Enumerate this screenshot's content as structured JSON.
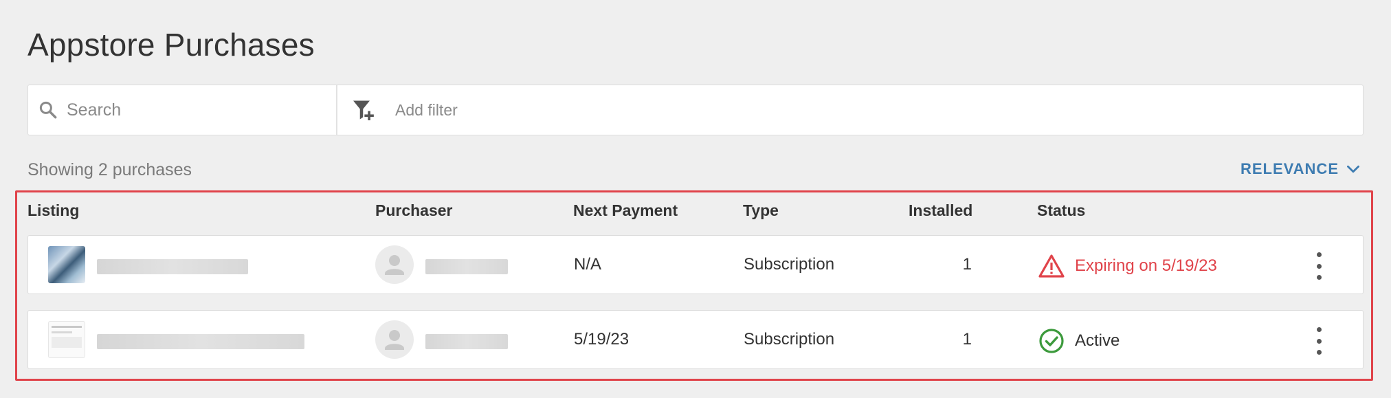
{
  "page": {
    "title": "Appstore Purchases"
  },
  "search": {
    "placeholder": "Search",
    "value": ""
  },
  "filter": {
    "label": "Add filter"
  },
  "results": {
    "count_text": "Showing 2 purchases"
  },
  "sort": {
    "label": "RELEVANCE"
  },
  "table": {
    "columns": [
      "Listing",
      "Purchaser",
      "Next Payment",
      "Type",
      "Installed",
      "Status"
    ],
    "rows": [
      {
        "next_payment": "N/A",
        "type": "Subscription",
        "installed": "1",
        "status": "Expiring on 5/19/23",
        "status_kind": "warning"
      },
      {
        "next_payment": "5/19/23",
        "type": "Subscription",
        "installed": "1",
        "status": "Active",
        "status_kind": "success"
      }
    ]
  },
  "colors": {
    "accent": "#3e7cb1",
    "warning": "#e0434a",
    "success": "#3c9a3c",
    "highlight_border": "#e0434a"
  },
  "icons": [
    "search-icon",
    "add-filter-icon",
    "chevron-down-icon",
    "person-icon",
    "warning-triangle-icon",
    "check-circle-icon",
    "more-vertical-icon"
  ]
}
